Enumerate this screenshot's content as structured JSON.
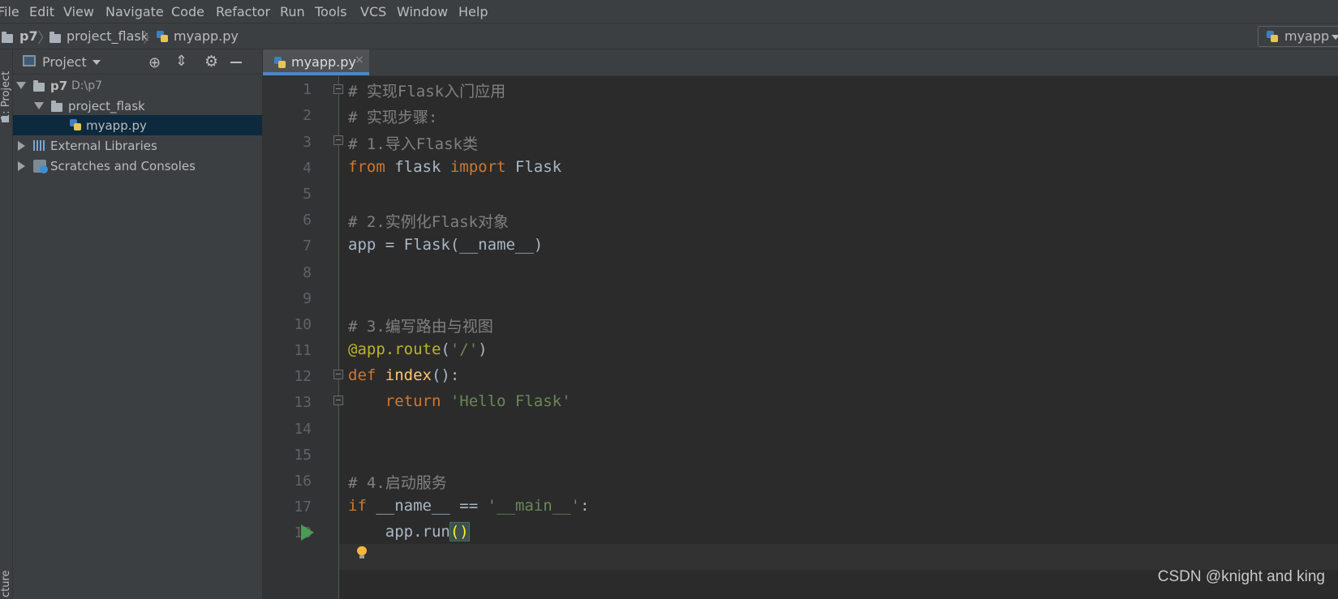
{
  "menu": {
    "file": "File",
    "edit": "Edit",
    "view": "View",
    "navigate": "Navigate",
    "code": "Code",
    "refactor": "Refactor",
    "run": "Run",
    "tools": "Tools",
    "vcs": "VCS",
    "window": "Window",
    "help": "Help"
  },
  "breadcrumbs": [
    "p7",
    "project_flask",
    "myapp.py"
  ],
  "run_config": "myapp",
  "left_stripe": {
    "project": "1: Project",
    "structure": "cture"
  },
  "project_panel": {
    "title": "Project",
    "tree": [
      {
        "label": "p7",
        "extra": "D:\\p7",
        "expanded": true
      },
      {
        "label": "project_flask",
        "expanded": true
      },
      {
        "label": "myapp.py",
        "selected": true
      },
      {
        "label": "External Libraries",
        "expanded": false
      },
      {
        "label": "Scratches and Consoles",
        "expanded": false
      }
    ]
  },
  "editor": {
    "tab": "myapp.py",
    "tab_close": "×",
    "line_numbers": [
      "1",
      "2",
      "3",
      "4",
      "5",
      "6",
      "7",
      "8",
      "9",
      "10",
      "11",
      "12",
      "13",
      "14",
      "15",
      "16",
      "17",
      "18"
    ],
    "code": {
      "l1": "# 实现Flask入门应用",
      "l2": "# 实现步骤:",
      "l3": "# 1.导入Flask类",
      "l4_from": "from",
      "l4_mod": " flask ",
      "l4_import": "import",
      "l4_name": " Flask",
      "l6": "# 2.实例化Flask对象",
      "l7": "app = Flask(__name__)",
      "l10": "# 3.编写路由与视图",
      "l11_dec": "@app.route",
      "l11_open": "(",
      "l11_str": "'/'",
      "l11_close": ")",
      "l12_def": "def",
      "l12_fn": " index",
      "l12_rest": "():",
      "l13_indent": "    ",
      "l13_ret": "return",
      "l13_str": " 'Hello Flask'",
      "l16": "# 4.启动服务",
      "l17_if": "if",
      "l17_mid": " __name__ == ",
      "l17_str": "'__main__'",
      "l17_end": ":",
      "l18_indent": "    ",
      "l18_call": "app.run",
      "l18_paren": "()"
    }
  },
  "watermark": "CSDN @knight and king",
  "colors": {
    "comment": "#808080",
    "keyword": "#cc7832",
    "string": "#6a8759",
    "decorator": "#bbb529",
    "function": "#ffc66d",
    "selection": "#0d293e",
    "tab_underline": "#4a88c7"
  }
}
